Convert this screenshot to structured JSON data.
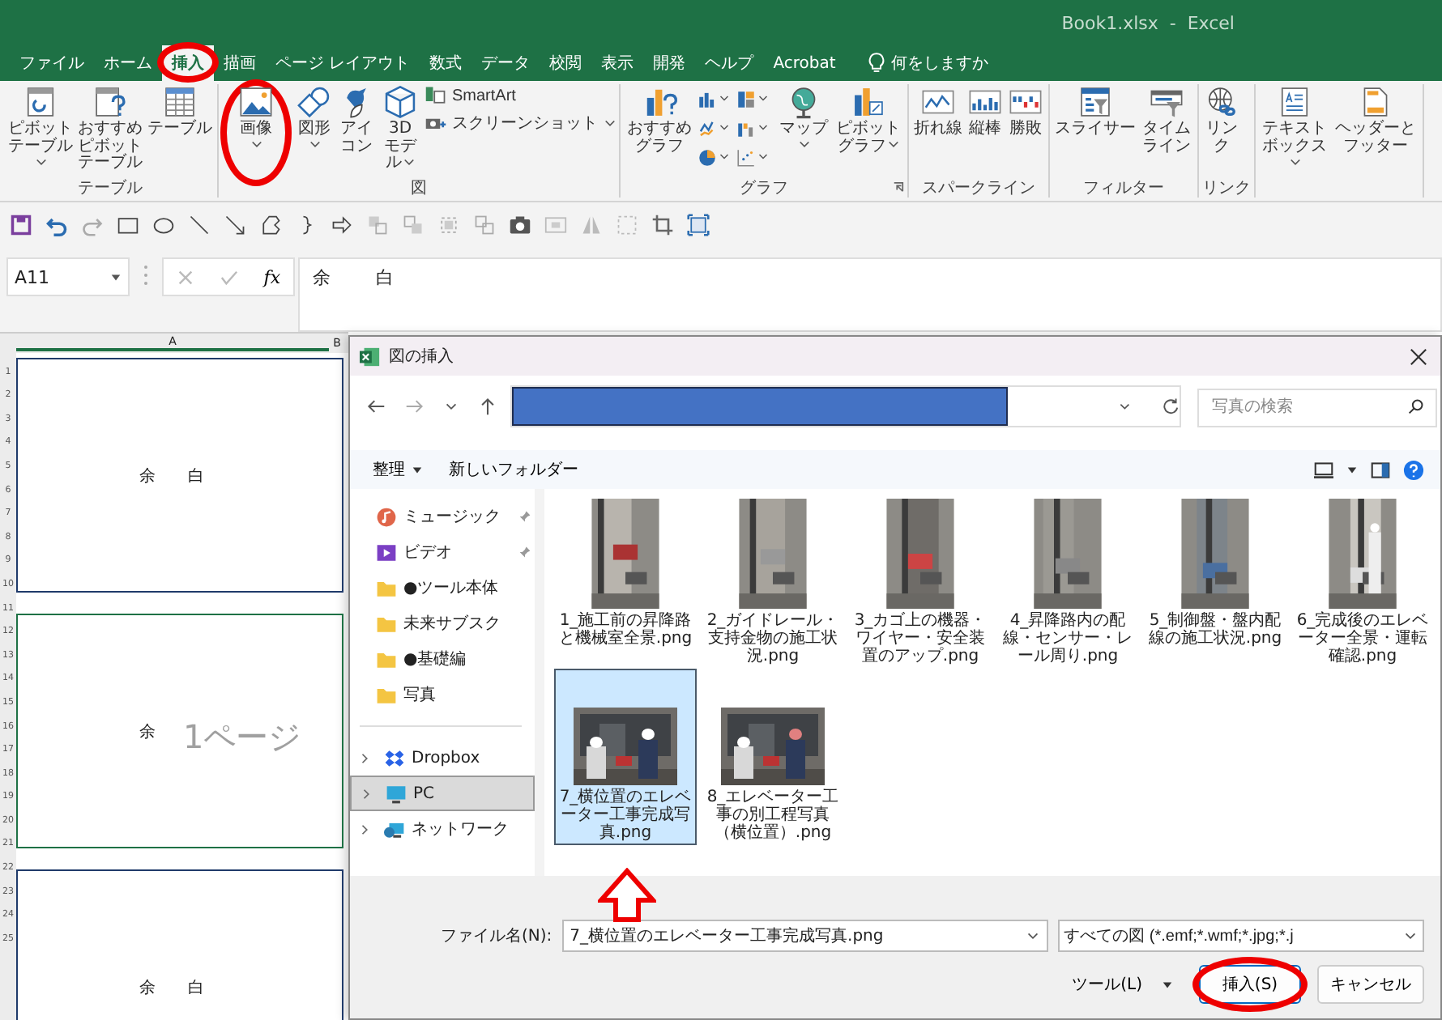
{
  "window": {
    "title": "Book1.xlsx  -  Excel"
  },
  "ribbon_tabs": [
    {
      "label": "ファイル",
      "selected": false
    },
    {
      "label": "ホーム",
      "selected": false
    },
    {
      "label": "挿入",
      "selected": true
    },
    {
      "label": "描画",
      "selected": false
    },
    {
      "label": "ページ レイアウト",
      "selected": false
    },
    {
      "label": "数式",
      "selected": false
    },
    {
      "label": "データ",
      "selected": false
    },
    {
      "label": "校閲",
      "selected": false
    },
    {
      "label": "表示",
      "selected": false
    },
    {
      "label": "開発",
      "selected": false
    },
    {
      "label": "ヘルプ",
      "selected": false
    },
    {
      "label": "Acrobat",
      "selected": false
    }
  ],
  "tell_me": "何をしますか",
  "ribbon_groups": [
    {
      "label": "テーブル",
      "buttons": [
        {
          "label": "ピボットテーブル",
          "dropdown": true
        },
        {
          "label": "おすすめピボットテーブル",
          "dropdown": false
        },
        {
          "label": "テーブル",
          "dropdown": false
        }
      ]
    },
    {
      "label": "図",
      "buttons": [
        {
          "label": "画像",
          "dropdown": true
        },
        {
          "label": "図形",
          "dropdown": true
        },
        {
          "label": "アイコン",
          "dropdown": false
        },
        {
          "label": "3D モデル",
          "dropdown": true
        }
      ],
      "small_buttons": [
        {
          "label": "SmartArt",
          "dropdown": false
        },
        {
          "label": "スクリーンショット",
          "dropdown": true
        }
      ]
    },
    {
      "label": "グラフ",
      "buttons": [
        {
          "label": "おすすめグラフ",
          "dropdown": false
        },
        {
          "label": "マップ",
          "dropdown": true
        },
        {
          "label": "ピボットグラフ",
          "dropdown": true
        }
      ]
    },
    {
      "label": "スパークライン",
      "buttons": [
        {
          "label": "折れ線",
          "dropdown": false
        },
        {
          "label": "縦棒",
          "dropdown": false
        },
        {
          "label": "勝敗",
          "dropdown": false
        }
      ]
    },
    {
      "label": "フィルター",
      "buttons": [
        {
          "label": "スライサー",
          "dropdown": false
        },
        {
          "label": "タイムライン",
          "dropdown": false
        }
      ]
    },
    {
      "label": "リンク",
      "buttons": [
        {
          "label": "リンク",
          "dropdown": false
        }
      ]
    },
    {
      "buttons": [
        {
          "label": "テキストボックス",
          "dropdown": true
        },
        {
          "label": "ヘッダーとフッター",
          "dropdown": false
        }
      ]
    }
  ],
  "name_box": "A11",
  "function_label": "fx",
  "formula": "余        白",
  "sheet": {
    "column_headers": [
      "A",
      "B"
    ],
    "row_numbers": [
      "1",
      "2",
      "3",
      "4",
      "5",
      "6",
      "7",
      "8",
      "9",
      "10",
      "11",
      "12",
      "13",
      "14",
      "15",
      "16",
      "17",
      "18",
      "19",
      "20",
      "21",
      "22",
      "23",
      "24",
      "25"
    ],
    "pages": [
      {
        "texts": [
          "余",
          "白"
        ],
        "selected": false
      },
      {
        "texts": [
          "余"
        ],
        "selected": true
      },
      {
        "texts": [
          "余",
          "白"
        ],
        "selected": false
      }
    ],
    "page_label": "1ページ"
  },
  "dialog": {
    "title": "図の挿入",
    "search": {
      "placeholder": "写真の検索"
    },
    "organize": "整理",
    "new_folder": "新しいフォルダー",
    "sidebar": [
      {
        "label": "ミュージック",
        "kind": "quick",
        "pinned": true,
        "selected": false
      },
      {
        "label": "ビデオ",
        "kind": "quick",
        "pinned": true,
        "selected": false
      },
      {
        "label": "●ツール本体",
        "kind": "quick",
        "pinned": false,
        "selected": false
      },
      {
        "label": "未来サブスク",
        "kind": "quick",
        "pinned": false,
        "selected": false
      },
      {
        "label": "●基礎編",
        "kind": "quick",
        "pinned": false,
        "selected": false
      },
      {
        "label": "写真",
        "kind": "quick",
        "pinned": false,
        "selected": false
      },
      {
        "label": "Dropbox",
        "kind": "location",
        "pinned": false,
        "selected": false
      },
      {
        "label": "PC",
        "kind": "location",
        "pinned": false,
        "selected": true
      },
      {
        "label": "ネットワーク",
        "kind": "location",
        "pinned": false,
        "selected": false
      }
    ],
    "files": [
      {
        "name": "1_施工前の昇降路と機械室全景.png",
        "selected": false
      },
      {
        "name": "2_ガイドレール・支持金物の施工状況.png",
        "selected": false
      },
      {
        "name": "3_カゴ上の機器・ワイヤー・安全装置のアップ.png",
        "selected": false
      },
      {
        "name": "4_昇降路内の配線・センサー・レール周り.png",
        "selected": false
      },
      {
        "name": "5_制御盤・盤内配線の施工状況.png",
        "selected": false
      },
      {
        "name": "6_完成後のエレベーター全景・運転確認.png",
        "selected": false
      },
      {
        "name": "7_横位置のエレベーター工事完成写真.png",
        "selected": true
      },
      {
        "name": "8_エレベーター工事の別工程写真（横位置）.png",
        "selected": false
      }
    ],
    "file_name_label": "ファイル名(N):",
    "file_name": "7_横位置のエレベーター工事完成写真.png",
    "file_type": "すべての図 (*.emf;*.wmf;*.jpg;*.j",
    "tools_button": "ツール(L)",
    "insert_button": "挿入(S)",
    "cancel_button": "キャンセル"
  }
}
